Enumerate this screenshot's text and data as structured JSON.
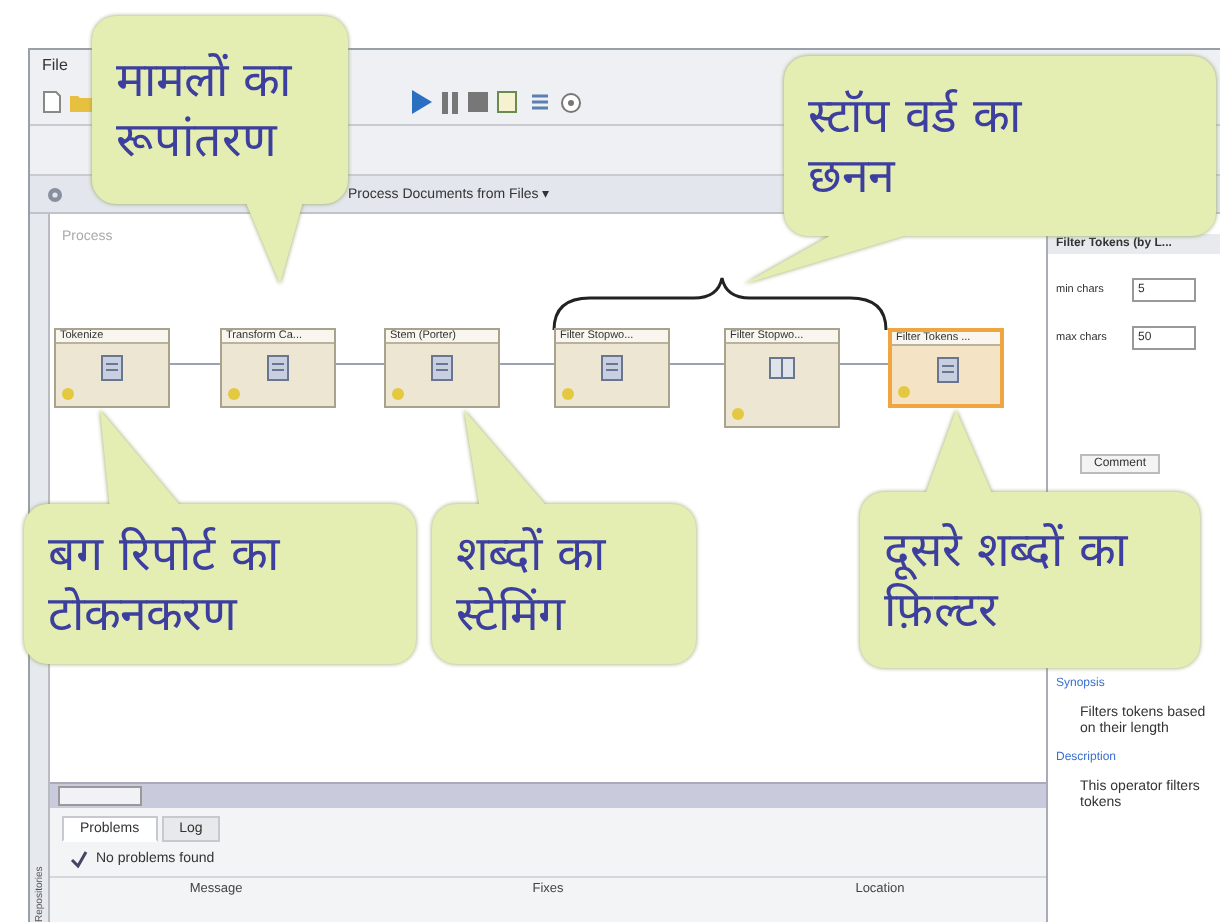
{
  "menu": [
    "File"
  ],
  "breadcrumb": "Process Documents from Files ▾",
  "side_tab": "Repositories",
  "canvas": {
    "label": "Process",
    "operators": [
      {
        "title": "Tokenize",
        "selected": false,
        "kind": "simple"
      },
      {
        "title": "Transform Ca...",
        "selected": false,
        "kind": "simple"
      },
      {
        "title": "Stem (Porter)",
        "selected": false,
        "kind": "simple"
      },
      {
        "title": "Filter Stopwo...",
        "selected": false,
        "kind": "simple"
      },
      {
        "title": "Filter Stopwo...",
        "selected": false,
        "kind": "dictionary"
      },
      {
        "title": "Filter Tokens ...",
        "selected": true,
        "kind": "simple"
      }
    ]
  },
  "callouts": [
    {
      "text": "मामलों का\nरूपांतरण"
    },
    {
      "text": "स्टॉप वर्ड का\nछनन"
    },
    {
      "text": "बग रिपोर्ट का\nटोकनकरण"
    },
    {
      "text": "शब्दों का\nस्टेमिंग"
    },
    {
      "text": "दूसरे शब्दों का\nफ़िल्टर"
    }
  ],
  "parameters": {
    "title": "Filter Tokens (by L...",
    "params": [
      {
        "label": "min chars",
        "value": "5"
      },
      {
        "label": "max chars",
        "value": "50"
      }
    ],
    "comment": "Comment"
  },
  "help": {
    "synopsis_heading": "Synopsis",
    "synopsis": "Filters tokens based on their length",
    "description_heading": "Description",
    "description": "This operator filters tokens"
  },
  "bottom_panel": {
    "tabs": [
      {
        "label": "Problems",
        "selected": true
      },
      {
        "label": "Log",
        "selected": false
      }
    ],
    "status": "No problems found",
    "columns": [
      "Message",
      "Fixes",
      "Location"
    ]
  }
}
